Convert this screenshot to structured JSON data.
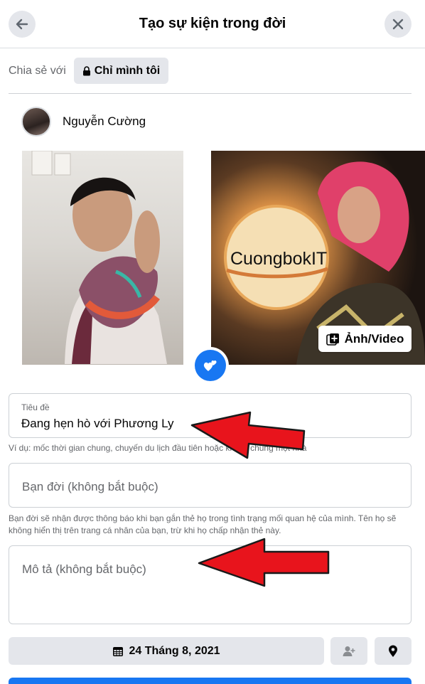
{
  "header": {
    "title": "Tạo sự kiện trong đời",
    "back_icon": "arrow-left-icon",
    "close_icon": "close-icon"
  },
  "share": {
    "label": "Chia sẻ với",
    "privacy": "Chỉ mình tôi",
    "privacy_icon": "lock-icon"
  },
  "author": {
    "name": "Nguyễn Cường"
  },
  "photos": {
    "watermark": "CuongbokIT",
    "media_button": "Ảnh/Video",
    "media_icon": "add-photo-icon",
    "badge_icon": "hearts-icon"
  },
  "form": {
    "title_label": "Tiêu đề",
    "title_value": "Đang hẹn hò với Phương Ly",
    "title_hint": "Ví dụ: mốc thời gian chung, chuyến du lịch đầu tiên hoặc khi về chung một nhà",
    "partner_placeholder": "Bạn đời (không bắt buộc)",
    "partner_hint": "Bạn đời sẽ nhận được thông báo khi bạn gắn thẻ họ trong tình trạng mối quan hệ của mình. Tên họ sẽ không hiển thị trên trang cá nhân của bạn, trừ khi họ chấp nhận thẻ này.",
    "description_placeholder": "Mô tả (không bắt buộc)"
  },
  "footer": {
    "date": "24 Tháng 8, 2021",
    "date_icon": "calendar-icon",
    "people_icon": "tag-people-icon",
    "location_icon": "location-pin-icon"
  },
  "colors": {
    "accent": "#1877f2",
    "button_bg": "#e4e6eb",
    "annotation_arrow": "#e8141c"
  }
}
